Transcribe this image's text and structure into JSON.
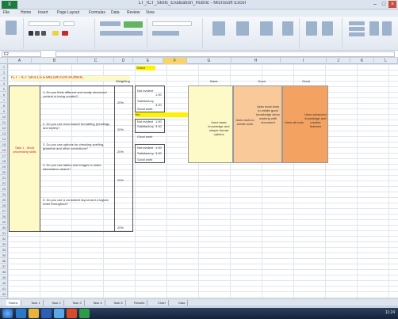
{
  "app": {
    "logo_text": "X",
    "title": "LT_ICT_Skills_Evaluation_Rubric - Microsoft Excel",
    "min": "–",
    "max": "□",
    "close": "×"
  },
  "menu": [
    "File",
    "Home",
    "Insert",
    "Page Layout",
    "Formulas",
    "Data",
    "Review",
    "View"
  ],
  "namebox": "F2",
  "columns": [
    "A",
    "B",
    "C",
    "D",
    "E",
    "F",
    "G",
    "H",
    "I",
    "J",
    "K",
    "L"
  ],
  "rows": [
    "1",
    "2",
    "3",
    "4",
    "5",
    "6",
    "7",
    "8",
    "9",
    "10",
    "11",
    "12",
    "13",
    "14",
    "15",
    "16",
    "17",
    "18",
    "19",
    "20",
    "21",
    "22",
    "23",
    "24",
    "25",
    "26",
    "27",
    "28",
    "29",
    "30",
    "31",
    "32",
    "33",
    "34",
    "35",
    "36",
    "37",
    "38",
    "39",
    "40",
    "41",
    "42"
  ],
  "sheet": {
    "title": "ICT - ICT SKILLS EVALUATION RUBRIC",
    "select_label": "Select",
    "weighting_header": "Weighting",
    "levels": [
      "Basic",
      "Good",
      "Great"
    ],
    "category": "Task 1 - Word processing skills",
    "questions": [
      {
        "q": "1. Do you think different and neatly structured content is being created?",
        "w": "20%"
      },
      {
        "q": "2. Do you use word-based formatting (headings and styles)?",
        "w": "20%"
      },
      {
        "q": "3. Do you use options for checking spelling, grammar and other corrections?",
        "w": "20%"
      },
      {
        "q": "4. Do you use tables and images to make information clearer?",
        "w": "20%"
      },
      {
        "q": "5. Do you use a consistent layout and a logical order throughout?",
        "w": "20%"
      }
    ],
    "options_a": [
      "Not evident",
      "Satisfactory",
      "Good work"
    ],
    "options_a_vals": [
      "1.00",
      "3.00",
      ""
    ],
    "options_b": [
      "Not evident",
      "Satisfactory",
      "Good work"
    ],
    "options_b_vals": [
      "1.00",
      "3.00",
      ""
    ],
    "options_c": [
      "Not evident",
      "Satisfactory",
      "Good work"
    ],
    "options_c_vals": [
      "1.00",
      "3.00",
      ""
    ],
    "yes_label": "Yes",
    "small_note": "0 points from rubric",
    "basic_text": "Uses basic knowledge and simple format options",
    "good_text_1": "Uses tools to create work",
    "good_text_2": "Uses most tools to create good knowledge when working with document",
    "great_text_1": "Uses all tools",
    "great_text_2": "Uses advanced knowledge and creates features"
  },
  "sheet_tabs": [
    "Rubric",
    "Task 1",
    "Task 2",
    "Task 3",
    "Task 4",
    "Task 5",
    "Results",
    "Chart",
    "Data"
  ],
  "clock": "11:24",
  "colors": {
    "yellow": "#fdfac8",
    "orange": "#f9c99a",
    "dark_orange": "#f3a262",
    "highlight": "#fff200"
  }
}
